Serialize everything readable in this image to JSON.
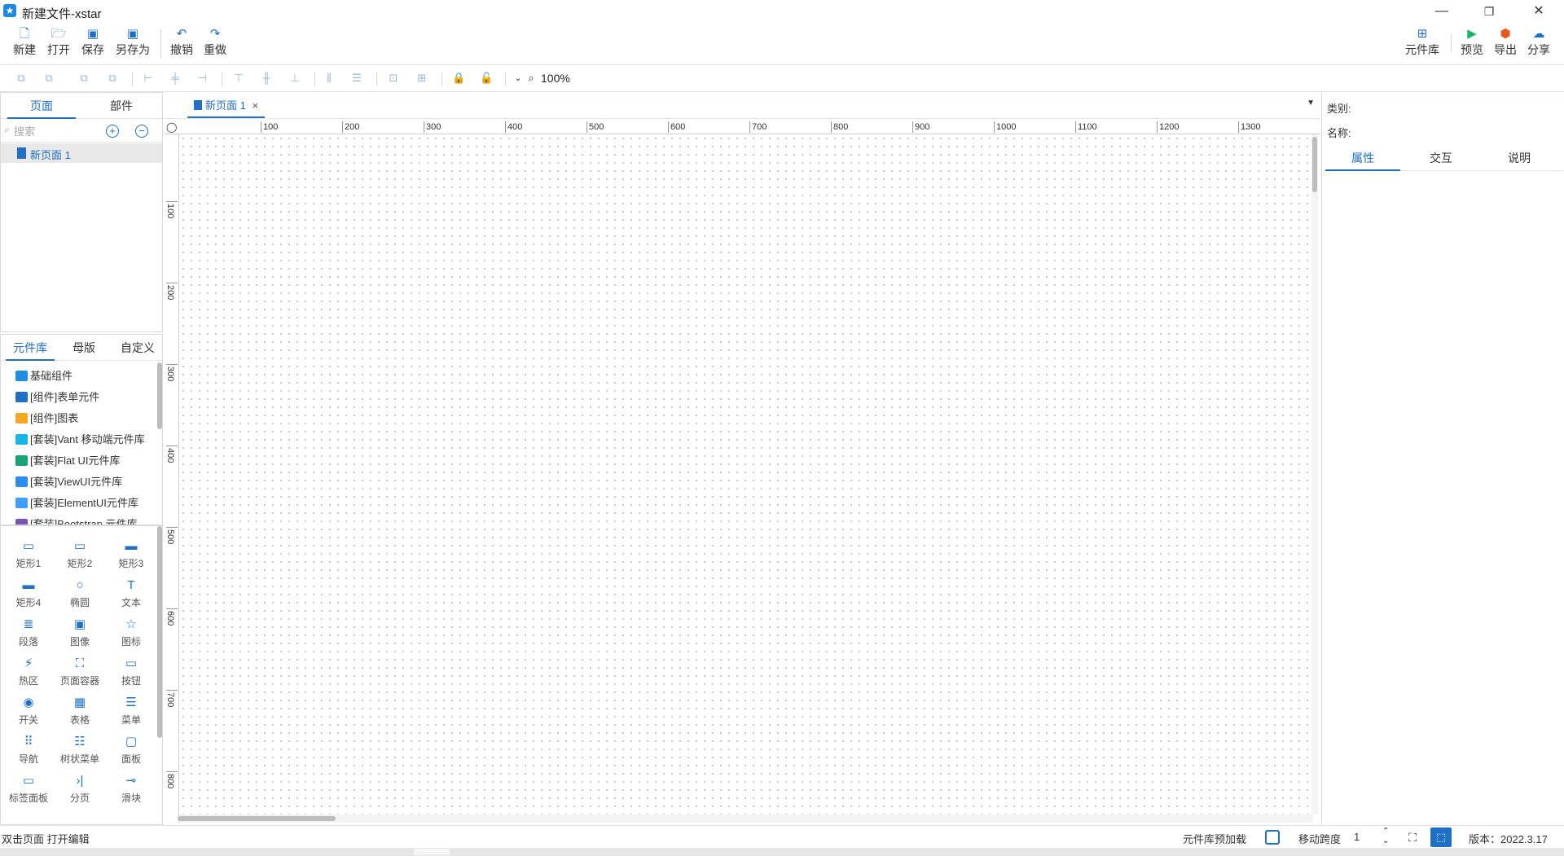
{
  "window": {
    "title": "新建文件-xstar",
    "minimize_glyph": "—",
    "maximize_glyph": "❐",
    "close_glyph": "✕"
  },
  "toolbar": {
    "new": "新建",
    "open": "打开",
    "save": "保存",
    "save_as": "另存为",
    "undo": "撤销",
    "redo": "重做",
    "library": "元件库",
    "preview": "预览",
    "export": "导出",
    "share": "分享"
  },
  "format_bar": {
    "zoom": "100%"
  },
  "left_panel": {
    "tabs": [
      "页面",
      "部件"
    ],
    "search_placeholder": "搜索",
    "pages": [
      "新页面 1"
    ]
  },
  "library_panel": {
    "tabs": [
      "元件库",
      "母版",
      "自定义"
    ],
    "items": [
      {
        "label": "基础组件",
        "icon": "diamond-icon",
        "color": "#1f8fe5"
      },
      {
        "label": "[组件]表单元件",
        "icon": "form-icon",
        "color": "#1f6fc5"
      },
      {
        "label": "[组件]图表",
        "icon": "bar-chart-icon",
        "color": "#f5a623"
      },
      {
        "label": "[套装]Vant 移动端元件库",
        "icon": "vant-icon",
        "color": "#19b5e8"
      },
      {
        "label": "[套装]Flat UI元件库",
        "icon": "flat-ui-icon",
        "color": "#1aa37a"
      },
      {
        "label": "[套装]ViewUI元件库",
        "icon": "view-ui-icon",
        "color": "#2d8cf0"
      },
      {
        "label": "[套装]ElementUI元件库",
        "icon": "element-ui-icon",
        "color": "#409eff"
      },
      {
        "label": "[套装]Bootstrap 元件库",
        "icon": "bootstrap-icon",
        "color": "#7952b3"
      }
    ]
  },
  "components": [
    {
      "label": "矩形1",
      "icon": "rectangle-outline-icon",
      "glyph": "▭"
    },
    {
      "label": "矩形2",
      "icon": "rectangle-outline-icon",
      "glyph": "▭"
    },
    {
      "label": "矩形3",
      "icon": "rectangle-light-icon",
      "glyph": "▬"
    },
    {
      "label": "矩形4",
      "icon": "rectangle-filled-icon",
      "glyph": "▬"
    },
    {
      "label": "椭圆",
      "icon": "ellipse-icon",
      "glyph": "○"
    },
    {
      "label": "文本",
      "icon": "text-icon",
      "glyph": "T"
    },
    {
      "label": "段落",
      "icon": "paragraph-icon",
      "glyph": "≣"
    },
    {
      "label": "图像",
      "icon": "image-icon",
      "glyph": "▣"
    },
    {
      "label": "图标",
      "icon": "star-icon",
      "glyph": "☆"
    },
    {
      "label": "热区",
      "icon": "hotspot-icon",
      "glyph": "⚡"
    },
    {
      "label": "页面容器",
      "icon": "page-container-icon",
      "glyph": "⛶"
    },
    {
      "label": "按钮",
      "icon": "button-icon",
      "glyph": "▭"
    },
    {
      "label": "开关",
      "icon": "toggle-icon",
      "glyph": "◉"
    },
    {
      "label": "表格",
      "icon": "table-icon",
      "glyph": "▦"
    },
    {
      "label": "菜单",
      "icon": "menu-icon",
      "glyph": "☰"
    },
    {
      "label": "导航",
      "icon": "nav-icon",
      "glyph": "⠿"
    },
    {
      "label": "树状菜单",
      "icon": "tree-menu-icon",
      "glyph": "☷"
    },
    {
      "label": "面板",
      "icon": "panel-icon",
      "glyph": "▢"
    },
    {
      "label": "标签面板",
      "icon": "tab-panel-icon",
      "glyph": "▭"
    },
    {
      "label": "分页",
      "icon": "pagination-icon",
      "glyph": "›|"
    },
    {
      "label": "滑块",
      "icon": "slider-icon",
      "glyph": "⊸"
    }
  ],
  "canvas": {
    "doc_tab": "新页面 1",
    "doc_tab_close": "×",
    "origin_glyph": "◯",
    "h_ruler": [
      "100",
      "200",
      "300",
      "400",
      "500",
      "600",
      "700",
      "800",
      "900",
      "1000",
      "1100",
      "1200",
      "1300"
    ],
    "v_ruler": [
      "100",
      "200",
      "300",
      "400",
      "500",
      "600",
      "700",
      "800"
    ]
  },
  "right_panel": {
    "category_label": "类别:",
    "name_label": "名称:",
    "tabs": [
      "属性",
      "交互",
      "说明"
    ]
  },
  "status": {
    "hint": "双击页面 打开编辑",
    "preload_label": "元件库预加载",
    "move_step_label": "移动跨度",
    "move_step_value": "1",
    "version": "版本：2022.3.17"
  },
  "colors": {
    "accent": "#1f6fc5"
  }
}
